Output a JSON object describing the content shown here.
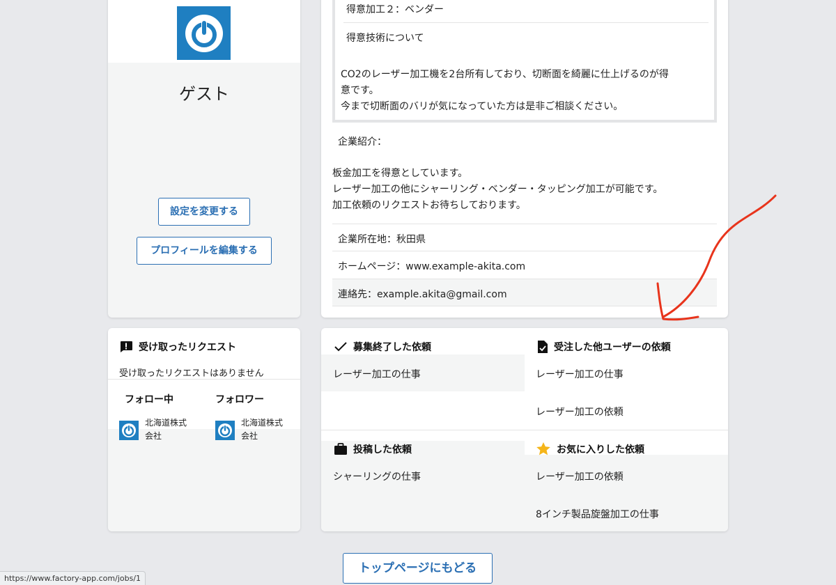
{
  "profile": {
    "name": "ゲスト",
    "settings_button": "設定を変更する",
    "edit_profile_button": "プロフィールを編集する"
  },
  "detail": {
    "skill_line_2": "得意加工２：ベンダー",
    "skill_heading": "得意技術について",
    "skill_body_1": "CO2のレーザー加工機を2台所有しており、切断面を綺麗に仕上げるのが得",
    "skill_body_2": "意です。",
    "skill_body_3": "今まで切断面のバリが気になっていた方は是非ご相談ください。",
    "intro_label": "企業紹介：",
    "intro_1": "板金加工を得意としています。",
    "intro_2": "レーザー加工の他にシャーリング・ベンダー・タッピング加工が可能です。",
    "intro_3": "加工依頼のリクエストお待ちしております。",
    "location": "企業所在地：秋田県",
    "homepage": "ホームページ：www.example-akita.com",
    "contact": "連絡先：example.akita@gmail.com"
  },
  "requests": {
    "title": "受け取ったリクエスト",
    "empty_text": "受け取ったリクエストはありません",
    "following_label": "フォロー中",
    "followers_label": "フォロワー",
    "following_company_1": "北海道株式",
    "following_company_2": "会社",
    "follower_company_1": "北海道株式",
    "follower_company_2": "会社"
  },
  "jobs": {
    "closed_title": "募集終了した依頼",
    "closed_items": [
      "レーザー加工の仕事"
    ],
    "accepted_title": "受注した他ユーザーの依頼",
    "accepted_items": [
      "レーザー加工の仕事",
      "レーザー加工の依頼"
    ],
    "posted_title": "投稿した依頼",
    "posted_items": [
      "シャーリングの仕事"
    ],
    "favorite_title": "お気に入りした依頼",
    "favorite_items": [
      "レーザー加工の依頼",
      "8インチ製品旋盤加工の仕事"
    ]
  },
  "back_button": "トップページにもどる",
  "status_url": "https://www.factory-app.com/jobs/1",
  "colors": {
    "accent": "#2b6fb3",
    "avatar_bg": "#1f7fc1",
    "annotation_arrow": "#e8341c",
    "star": "#f5b51a"
  }
}
